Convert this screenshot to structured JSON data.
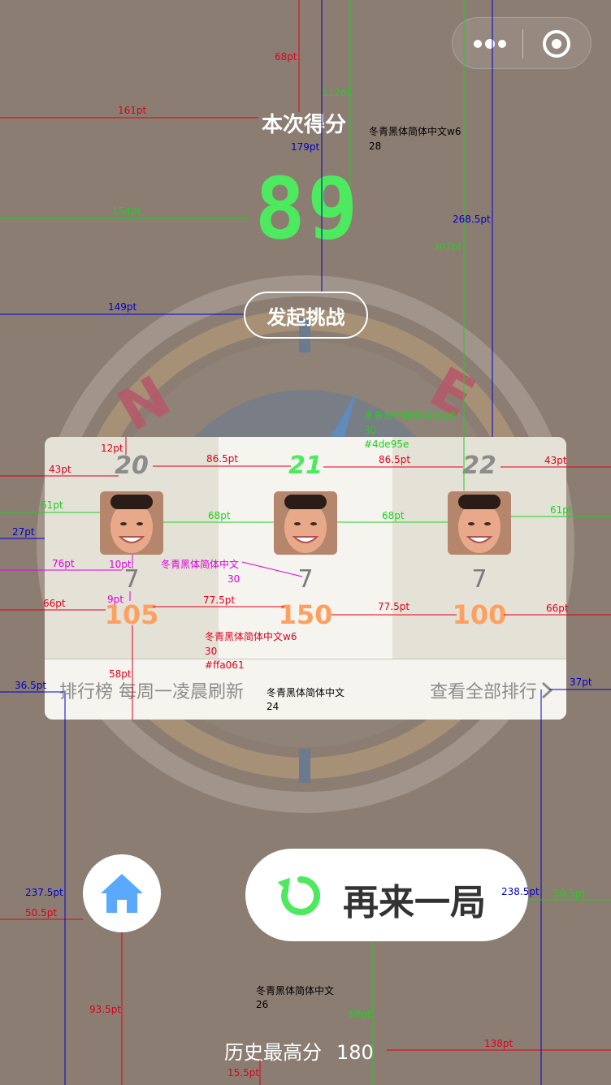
{
  "colors": {
    "background": "#8b7d72",
    "score": "#4de95e",
    "points": "#ffa061",
    "home_icon": "#5aa9ff",
    "card": "#e4e1d6",
    "card_highlight": "#f5f4ef"
  },
  "capsule": {
    "more_icon": "more-dots-icon",
    "close_icon": "target-icon"
  },
  "score": {
    "title": "本次得分",
    "value": "89"
  },
  "challenge": {
    "label": "发起挑战"
  },
  "ranking": {
    "entries": [
      {
        "rank": "20",
        "avatar": "avatar-face",
        "sub": "7",
        "points": "105"
      },
      {
        "rank": "21",
        "avatar": "avatar-face",
        "sub": "7",
        "points": "150"
      },
      {
        "rank": "22",
        "avatar": "avatar-face",
        "sub": "7",
        "points": "100"
      }
    ],
    "footer_left": "排行榜   每周一凌晨刷新",
    "footer_right": "查看全部排行"
  },
  "actions": {
    "home_icon": "home-icon",
    "again_icon": "refresh-icon",
    "again_label": "再来一局"
  },
  "history": {
    "label": "历史最高分",
    "value": "180"
  },
  "annotations": {
    "d68": "68pt",
    "d161": "161pt",
    "d112": "112pt",
    "d179": "179pt",
    "font_title": "冬青黑体简体中文w6",
    "font_title_size": "28",
    "d154": "154pt",
    "d268": "268.5pt",
    "d302": "302pt",
    "d149": "149pt",
    "font_rank": "冬青黑体简体中文w6",
    "font_rank_size": "30",
    "font_rank_color": "#4de95e",
    "d12": "12pt",
    "d43a": "43pt",
    "d86a": "86.5pt",
    "d86b": "86.5pt",
    "d43b": "43pt",
    "d61a": "61pt",
    "d68a": "68pt",
    "d68b": "68pt",
    "d61b": "61pt",
    "d27": "27pt",
    "d76": "76pt",
    "d10": "10pt",
    "font_sub": "冬青黑体简体中文",
    "font_sub_size": "30",
    "d9": "9pt",
    "d66a": "66pt",
    "d77a": "77.5pt",
    "d77b": "77.5pt",
    "d66b": "66pt",
    "font_pts": "冬青黑体简体中文w6",
    "font_pts_size": "30",
    "font_pts_color": "#ffa061",
    "d58": "58pt",
    "d36": "36.5pt",
    "font_footer": "冬青黑体简体中文",
    "font_footer_size": "24",
    "d37": "37pt",
    "d237": "237.5pt",
    "d50a": "50.5pt",
    "d238": "238.5pt",
    "d50b": "50.5pt",
    "d93": "93.5pt",
    "font_hist": "冬青黑体简体中文",
    "font_hist_size": "26",
    "d88": "88pt",
    "d138": "138pt",
    "d15": "15.5pt"
  }
}
